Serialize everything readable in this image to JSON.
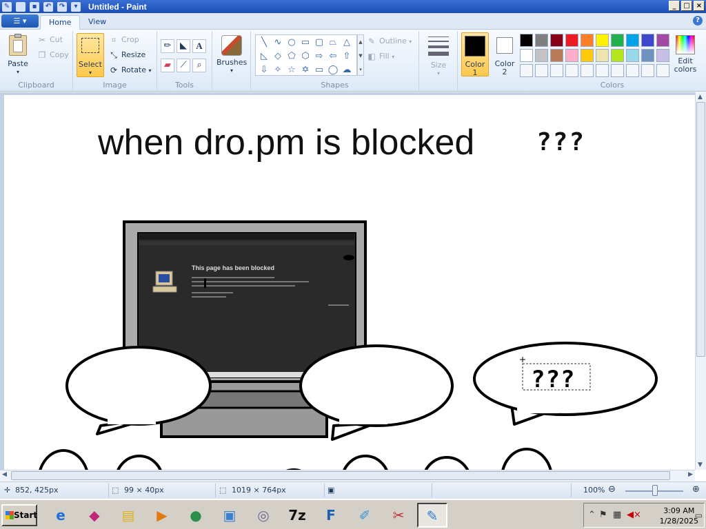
{
  "window": {
    "title": "Untitled - Paint",
    "controls": [
      "_",
      "□",
      "×"
    ]
  },
  "tabs": [
    {
      "label": "Home"
    },
    {
      "label": "View"
    }
  ],
  "ribbon": {
    "clipboard": {
      "label": "Clipboard",
      "paste": "Paste",
      "cut": "Cut",
      "copy": "Copy"
    },
    "image": {
      "label": "Image",
      "select": "Select",
      "crop": "Crop",
      "resize": "Resize",
      "rotate": "Rotate"
    },
    "tools": {
      "label": "Tools"
    },
    "brushes": {
      "label": "Brushes"
    },
    "shapes": {
      "label": "Shapes",
      "outline": "Outline",
      "fill": "Fill"
    },
    "size": {
      "label": "Size"
    },
    "color1": {
      "line1": "Color",
      "line2": "1",
      "value": "#000000"
    },
    "color2": {
      "line1": "Color",
      "line2": "2",
      "value": "#ffffff"
    },
    "colors": {
      "label": "Colors",
      "edit_line1": "Edit",
      "edit_line2": "colors",
      "row1": [
        "#000000",
        "#7f7f7f",
        "#880015",
        "#ed1c24",
        "#ff7f27",
        "#fff200",
        "#22b14c",
        "#00a2e8",
        "#3f48cc",
        "#a349a4"
      ],
      "row2": [
        "#ffffff",
        "#c3c3c3",
        "#b97a57",
        "#ffaec9",
        "#ffc90e",
        "#efe4b0",
        "#b5e61d",
        "#99d9ea",
        "#7092be",
        "#c8bfe7"
      ]
    }
  },
  "canvas": {
    "heading": "when dro.pm is blocked",
    "heading_suffix": "???",
    "bubble_text": "???",
    "screen_title": "This page has been blocked"
  },
  "status": {
    "cursor_pos": "852, 425px",
    "selection_size": "99 × 40px",
    "image_size": "1019 × 764px",
    "zoom": "100%"
  },
  "taskbar": {
    "start": "Start",
    "apps": [
      "internet-explorer",
      "nitro-pdf",
      "file-explorer",
      "media-player",
      "browser-globe",
      "network-tool",
      "disk-tool",
      "7zip",
      "filezilla",
      "notepad",
      "snipping-tool",
      "paint"
    ],
    "icons": [
      "e",
      "◆",
      "▤",
      "▶",
      "●",
      "▣",
      "◎",
      "7z",
      "F",
      "✐",
      "✂",
      "✎"
    ],
    "clock_time": "3:09 AM",
    "clock_date": "1/28/2025"
  }
}
